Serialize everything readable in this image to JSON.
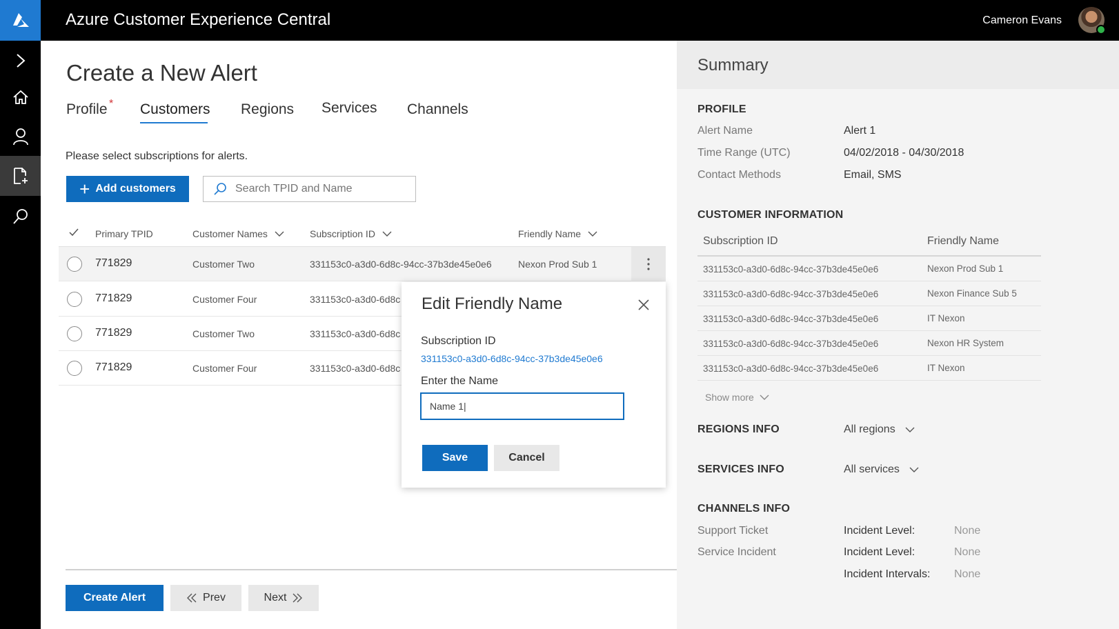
{
  "app": {
    "title": "Azure Customer Experience Central",
    "user_name": "Cameron Evans"
  },
  "page": {
    "title": "Create a New Alert",
    "instruction": "Please select subscriptions for alerts."
  },
  "tabs": [
    {
      "label": "Profile",
      "required_mark": "*"
    },
    {
      "label": "Customers"
    },
    {
      "label": "Regions"
    },
    {
      "label": "Services"
    },
    {
      "label": "Channels"
    }
  ],
  "toolbar": {
    "add_label": "Add customers",
    "search_placeholder": "Search TPID and Name"
  },
  "table": {
    "headers": [
      "Primary TPID",
      "Customer Names",
      "Subscription ID",
      "Friendly Name"
    ],
    "rows": [
      {
        "tpid": "771829",
        "customer": "Customer Two",
        "subscription": "331153c0-a3d0-6d8c-94cc-37b3de45e0e6",
        "friendly": "Nexon Prod Sub 1"
      },
      {
        "tpid": "771829",
        "customer": "Customer Four",
        "subscription": "331153c0-a3d0-6d8c",
        "friendly": ""
      },
      {
        "tpid": "771829",
        "customer": "Customer Two",
        "subscription": "331153c0-a3d0-6d8c",
        "friendly": ""
      },
      {
        "tpid": "771829",
        "customer": "Customer Four",
        "subscription": "331153c0-a3d0-6d8c",
        "friendly": ""
      }
    ]
  },
  "dialog": {
    "title": "Edit Friendly Name",
    "subscription_label": "Subscription ID",
    "subscription_value": "331153c0-a3d0-6d8c-94cc-37b3de45e0e6",
    "name_label": "Enter the Name",
    "name_value": "Name 1|",
    "save_label": "Save",
    "cancel_label": "Cancel"
  },
  "footer": {
    "create_label": "Create Alert",
    "prev_label": "Prev",
    "next_label": "Next"
  },
  "summary": {
    "title": "Summary",
    "profile": {
      "heading": "PROFILE",
      "items": [
        {
          "label": "Alert Name",
          "value": "Alert 1"
        },
        {
          "label": "Time Range (UTC)",
          "value": "04/02/2018 - 04/30/2018"
        },
        {
          "label": "Contact Methods",
          "value": "Email, SMS"
        }
      ]
    },
    "customer_info": {
      "heading": "CUSTOMER INFORMATION",
      "headers": [
        "Subscription ID",
        "Friendly Name"
      ],
      "rows": [
        {
          "sub": "331153c0-a3d0-6d8c-94cc-37b3de45e0e6",
          "name": "Nexon Prod Sub 1"
        },
        {
          "sub": "331153c0-a3d0-6d8c-94cc-37b3de45e0e6",
          "name": "Nexon Finance Sub 5"
        },
        {
          "sub": "331153c0-a3d0-6d8c-94cc-37b3de45e0e6",
          "name": "IT Nexon"
        },
        {
          "sub": "331153c0-a3d0-6d8c-94cc-37b3de45e0e6",
          "name": "Nexon HR System"
        },
        {
          "sub": "331153c0-a3d0-6d8c-94cc-37b3de45e0e6",
          "name": "IT Nexon"
        }
      ],
      "show_more": "Show more"
    },
    "regions": {
      "heading": "REGIONS INFO",
      "value": "All regions"
    },
    "services": {
      "heading": "SERVICES INFO",
      "value": "All services"
    },
    "channels": {
      "heading": "CHANNELS INFO",
      "rows": [
        {
          "label": "Support Ticket",
          "key": "Incident Level:",
          "value": "None"
        },
        {
          "label": "Service Incident",
          "key": "Incident Level:",
          "value": "None"
        },
        {
          "label": "",
          "key": "Incident Intervals:",
          "value": "None"
        }
      ]
    }
  },
  "colors": {
    "accent": "#0f6cbd",
    "topbar": "#000000",
    "status": "#2fb34a"
  },
  "icons": [
    "azure-logo-icon",
    "chevron-right-icon",
    "home-icon",
    "person-icon",
    "new-document-icon",
    "search-icon",
    "plus-icon",
    "checkmark-icon",
    "chevron-down-icon",
    "more-vertical-icon",
    "close-icon",
    "double-chevron-left-icon",
    "double-chevron-right-icon"
  ]
}
